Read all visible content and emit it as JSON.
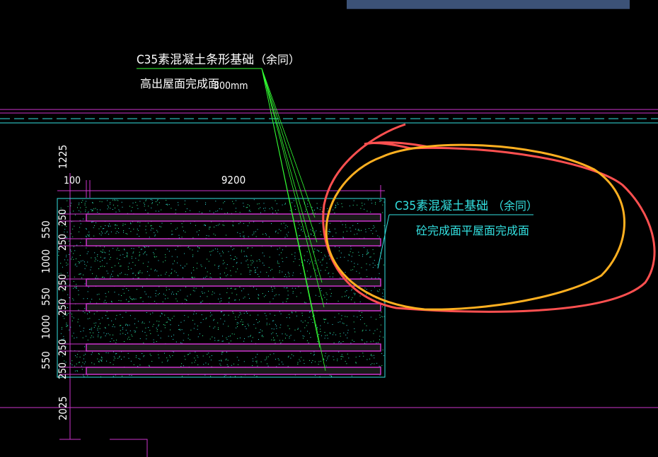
{
  "colors": {
    "background": "#000000",
    "outline": "#33e0e0",
    "strip": "#cc33cc",
    "leader": "#33ff33",
    "text": "#ffffff",
    "annotation_red": "#ff5050",
    "annotation_orange": "#ffb020"
  },
  "label_top": {
    "line1": "C35素混凝土条形基础",
    "suffix": "（余同）",
    "line2": "高出屋面完成面",
    "dim": "300mm"
  },
  "label_right": {
    "line1": "C35素混凝土基础",
    "suffix": "（余同）",
    "line2": "砼完成面平屋面完成面"
  },
  "dimensions": {
    "width": "9200",
    "offset": "100",
    "top": "1225",
    "bottom": "2025",
    "left_outer": [
      "550",
      "1000",
      "550",
      "1000",
      "550"
    ],
    "left_inner": [
      "250",
      "250",
      "250",
      "250",
      "250",
      "250"
    ]
  }
}
